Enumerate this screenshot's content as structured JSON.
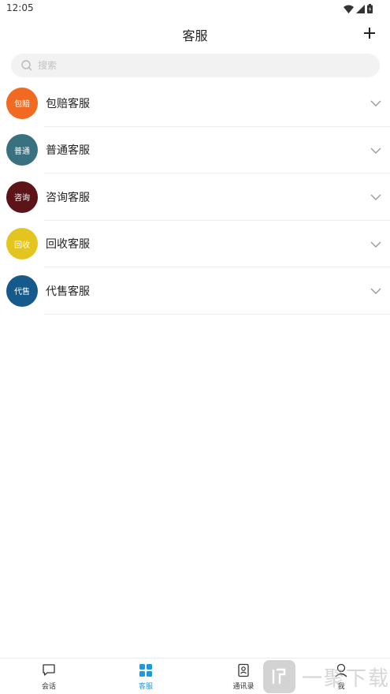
{
  "status_bar": {
    "time": "12:05"
  },
  "header": {
    "title": "客服"
  },
  "search": {
    "placeholder": "搜索",
    "value": ""
  },
  "groups": [
    {
      "label": "包赔客服",
      "avatar_text": "包赔",
      "avatar_color": "#f26a21"
    },
    {
      "label": "普通客服",
      "avatar_text": "普通",
      "avatar_color": "#3a7181"
    },
    {
      "label": "咨询客服",
      "avatar_text": "咨询",
      "avatar_color": "#5c1419"
    },
    {
      "label": "回收客服",
      "avatar_text": "回收",
      "avatar_color": "#e4c51f"
    },
    {
      "label": "代售客服",
      "avatar_text": "代售",
      "avatar_color": "#155a8a"
    }
  ],
  "bottom_nav": {
    "tabs": [
      {
        "label": "会话",
        "icon": "chat-icon",
        "active": false
      },
      {
        "label": "客服",
        "icon": "grid-icon",
        "active": true
      },
      {
        "label": "通讯录",
        "icon": "contacts-icon",
        "active": false
      },
      {
        "label": "我",
        "icon": "profile-icon",
        "active": false
      }
    ]
  },
  "watermark": {
    "text": "一聚下载"
  },
  "colors": {
    "accent": "#1a9bdc",
    "divider": "#eeeeee",
    "search_bg": "#f2f2f2"
  }
}
